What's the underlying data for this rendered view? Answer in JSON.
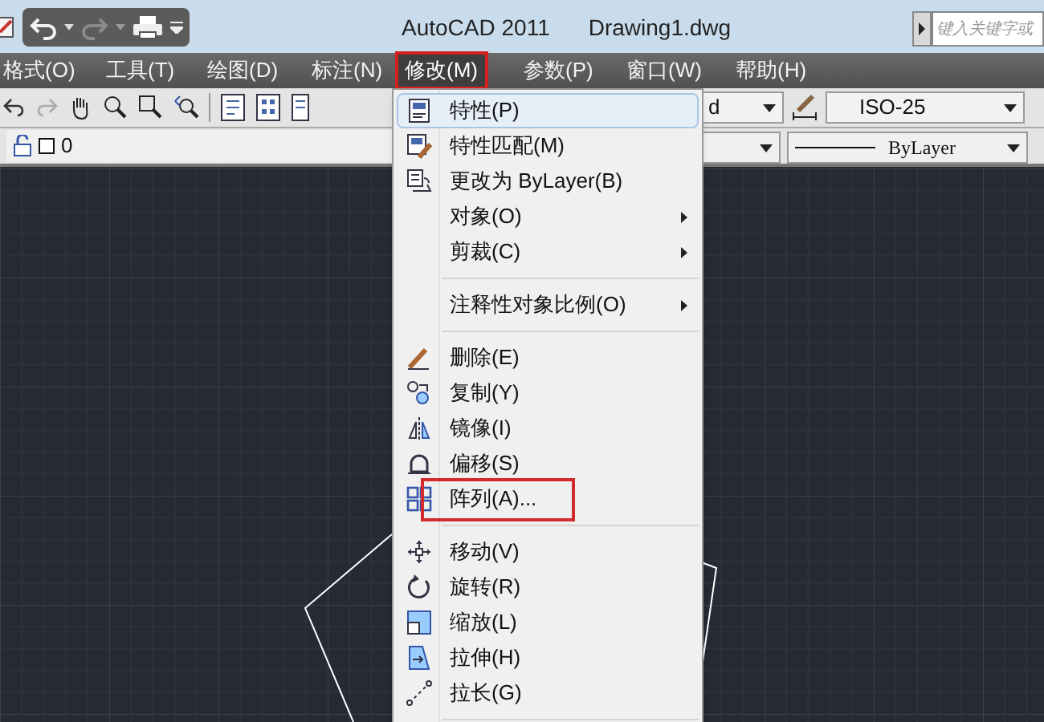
{
  "window": {
    "title": "AutoCAD 2011",
    "document": "Drawing1.dwg"
  },
  "search": {
    "placeholder": "键入关键字或"
  },
  "menu_bar": [
    {
      "label": "格式(O)",
      "selected": false,
      "annotated": false
    },
    {
      "label": "工具(T)",
      "selected": false,
      "annotated": false
    },
    {
      "label": "绘图(D)",
      "selected": false,
      "annotated": false
    },
    {
      "label": "标注(N)",
      "selected": false,
      "annotated": false
    },
    {
      "label": "修改(M)",
      "selected": true,
      "annotated": true
    },
    {
      "label": "参数(P)",
      "selected": false,
      "annotated": false
    },
    {
      "label": "窗口(W)",
      "selected": false,
      "annotated": false
    },
    {
      "label": "帮助(H)",
      "selected": false,
      "annotated": false
    }
  ],
  "toolbar": {
    "text_style": "d",
    "dim_style": "ISO-25",
    "layer": "0",
    "linetype": "ByLayer"
  },
  "menu": [
    {
      "kind": "item",
      "label": "特性(P)",
      "submenu": false,
      "highlighted": true,
      "annotated": false
    },
    {
      "kind": "item",
      "label": "特性匹配(M)",
      "submenu": false,
      "highlighted": false,
      "annotated": false
    },
    {
      "kind": "item",
      "label": "更改为 ByLayer(B)",
      "submenu": false,
      "highlighted": false,
      "annotated": false
    },
    {
      "kind": "item",
      "label": "对象(O)",
      "submenu": true,
      "highlighted": false,
      "annotated": false
    },
    {
      "kind": "item",
      "label": "剪裁(C)",
      "submenu": true,
      "highlighted": false,
      "annotated": false
    },
    {
      "kind": "separator"
    },
    {
      "kind": "item",
      "label": "注释性对象比例(O)",
      "submenu": true,
      "highlighted": false,
      "annotated": false
    },
    {
      "kind": "separator"
    },
    {
      "kind": "item",
      "label": "删除(E)",
      "submenu": false,
      "highlighted": false,
      "annotated": false
    },
    {
      "kind": "item",
      "label": "复制(Y)",
      "submenu": false,
      "highlighted": false,
      "annotated": false
    },
    {
      "kind": "item",
      "label": "镜像(I)",
      "submenu": false,
      "highlighted": false,
      "annotated": false
    },
    {
      "kind": "item",
      "label": "偏移(S)",
      "submenu": false,
      "highlighted": false,
      "annotated": false
    },
    {
      "kind": "item",
      "label": "阵列(A)...",
      "submenu": false,
      "highlighted": false,
      "annotated": true
    },
    {
      "kind": "separator"
    },
    {
      "kind": "item",
      "label": "移动(V)",
      "submenu": false,
      "highlighted": false,
      "annotated": false
    },
    {
      "kind": "item",
      "label": "旋转(R)",
      "submenu": false,
      "highlighted": false,
      "annotated": false
    },
    {
      "kind": "item",
      "label": "缩放(L)",
      "submenu": false,
      "highlighted": false,
      "annotated": false
    },
    {
      "kind": "item",
      "label": "拉伸(H)",
      "submenu": false,
      "highlighted": false,
      "annotated": false
    },
    {
      "kind": "item",
      "label": "拉长(G)",
      "submenu": false,
      "highlighted": false,
      "annotated": false
    },
    {
      "kind": "separator"
    }
  ]
}
